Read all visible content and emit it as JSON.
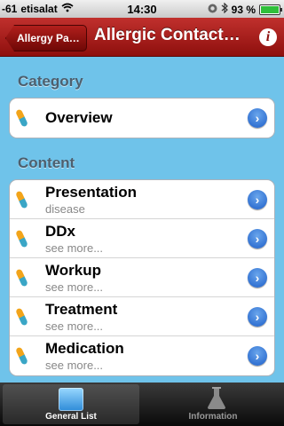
{
  "status_bar": {
    "signal": "-61",
    "carrier": "etisalat",
    "time": "14:30",
    "battery": "93 %",
    "battery_level": 0.93
  },
  "nav": {
    "back_label": "Allergy Pat…",
    "title": "Allergic Contact…"
  },
  "sections": {
    "category_header": "Category",
    "content_header": "Content"
  },
  "category_items": [
    {
      "title": "Overview"
    }
  ],
  "content_items": [
    {
      "title": "Presentation",
      "subtitle": "disease"
    },
    {
      "title": "DDx",
      "subtitle": "see more..."
    },
    {
      "title": "Workup",
      "subtitle": "see more..."
    },
    {
      "title": "Treatment",
      "subtitle": "see more..."
    },
    {
      "title": "Medication",
      "subtitle": "see more..."
    }
  ],
  "tabs": {
    "general_list": "General List",
    "information": "Information"
  },
  "colors": {
    "background": "#6fc3ea",
    "nav_bar": "#a8201d",
    "disclosure": "#2e6fd6"
  }
}
